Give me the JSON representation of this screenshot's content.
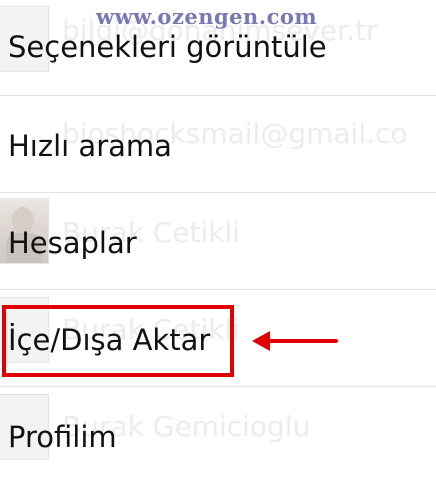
{
  "watermark": "www.ozengen.com",
  "background_contacts": [
    {
      "text": "bilgi@donanimsever.tr"
    },
    {
      "text": "bioshocksmail@gmail.co"
    },
    {
      "text": "Burak Cetikli"
    },
    {
      "text": "Burak Cetikli"
    },
    {
      "text": "Burak Gemicioglu"
    }
  ],
  "menu": {
    "items": [
      {
        "label": "Seçenekleri görüntüle"
      },
      {
        "label": "Hızlı arama"
      },
      {
        "label": "Hesaplar"
      },
      {
        "label": "İçe/Dışa Aktar"
      },
      {
        "label": "Profilim"
      }
    ],
    "highlighted_item": "İçe/Dışa Aktar"
  },
  "colors": {
    "highlight": "#e00000",
    "watermark": "#7a78b4",
    "menu_text": "#111111",
    "divider": "#e2e2e2"
  },
  "icons": {
    "arrow": "left-arrow-icon",
    "avatar": "contact-avatar-icon"
  }
}
